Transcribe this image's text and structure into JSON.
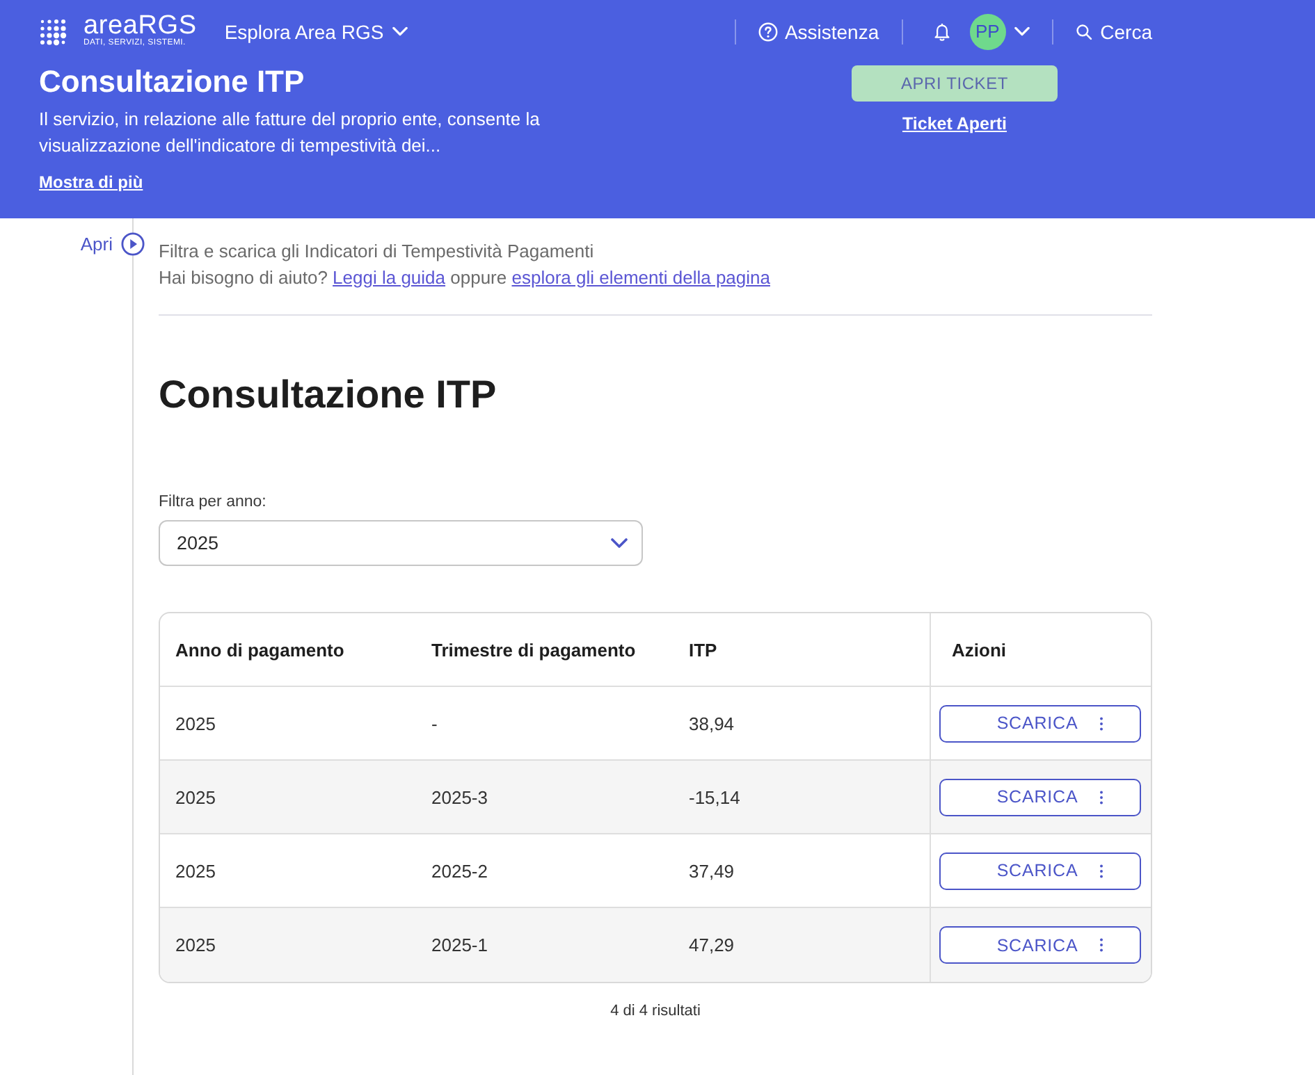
{
  "topbar": {
    "logo_name": "areaRGS",
    "logo_tagline": "DATI, SERVIZI, SISTEMI.",
    "explore_menu": "Esplora Area RGS",
    "help_link": "Assistenza",
    "avatar_initials": "PP",
    "search_button": "Cerca"
  },
  "hero": {
    "title": "Consultazione ITP",
    "description": "Il servizio, in relazione alle fatture del proprio ente, consente la visualizzazione dell'indicatore di tempestività dei...",
    "more_link": "Mostra di più",
    "ticket_button": "APRI TICKET",
    "tickets_link": "Ticket Aperti"
  },
  "side_panel": {
    "toggle_label": "Apri"
  },
  "intro": {
    "subtitle": "Filtra e scarica gli Indicatori di Tempestività Pagamenti",
    "help": [
      {
        "kind": "text",
        "text": "Hai bisogno di aiuto?"
      },
      {
        "kind": "link",
        "text": "Leggi la guida"
      },
      {
        "kind": "text",
        "text": "oppure"
      },
      {
        "kind": "link",
        "text": "esplora gli elementi della pagina"
      }
    ]
  },
  "page_title": "Consultazione ITP",
  "filter": {
    "label": "Filtra per anno:",
    "value": "2025"
  },
  "table": {
    "columns": [
      "Anno di pagamento",
      "Trimestre di pagamento",
      "ITP",
      "Azioni"
    ],
    "rows": [
      {
        "cells": [
          "2025",
          "-",
          "38,94"
        ],
        "action": "SCARICA"
      },
      {
        "cells": [
          "2025",
          "2025-3",
          "-15,14"
        ],
        "action": "SCARICA"
      },
      {
        "cells": [
          "2025",
          "2025-2",
          "37,49"
        ],
        "action": "SCARICA"
      },
      {
        "cells": [
          "2025",
          "2025-1",
          "47,29"
        ],
        "action": "SCARICA"
      }
    ]
  },
  "results_count": "4 di 4 risultati"
}
